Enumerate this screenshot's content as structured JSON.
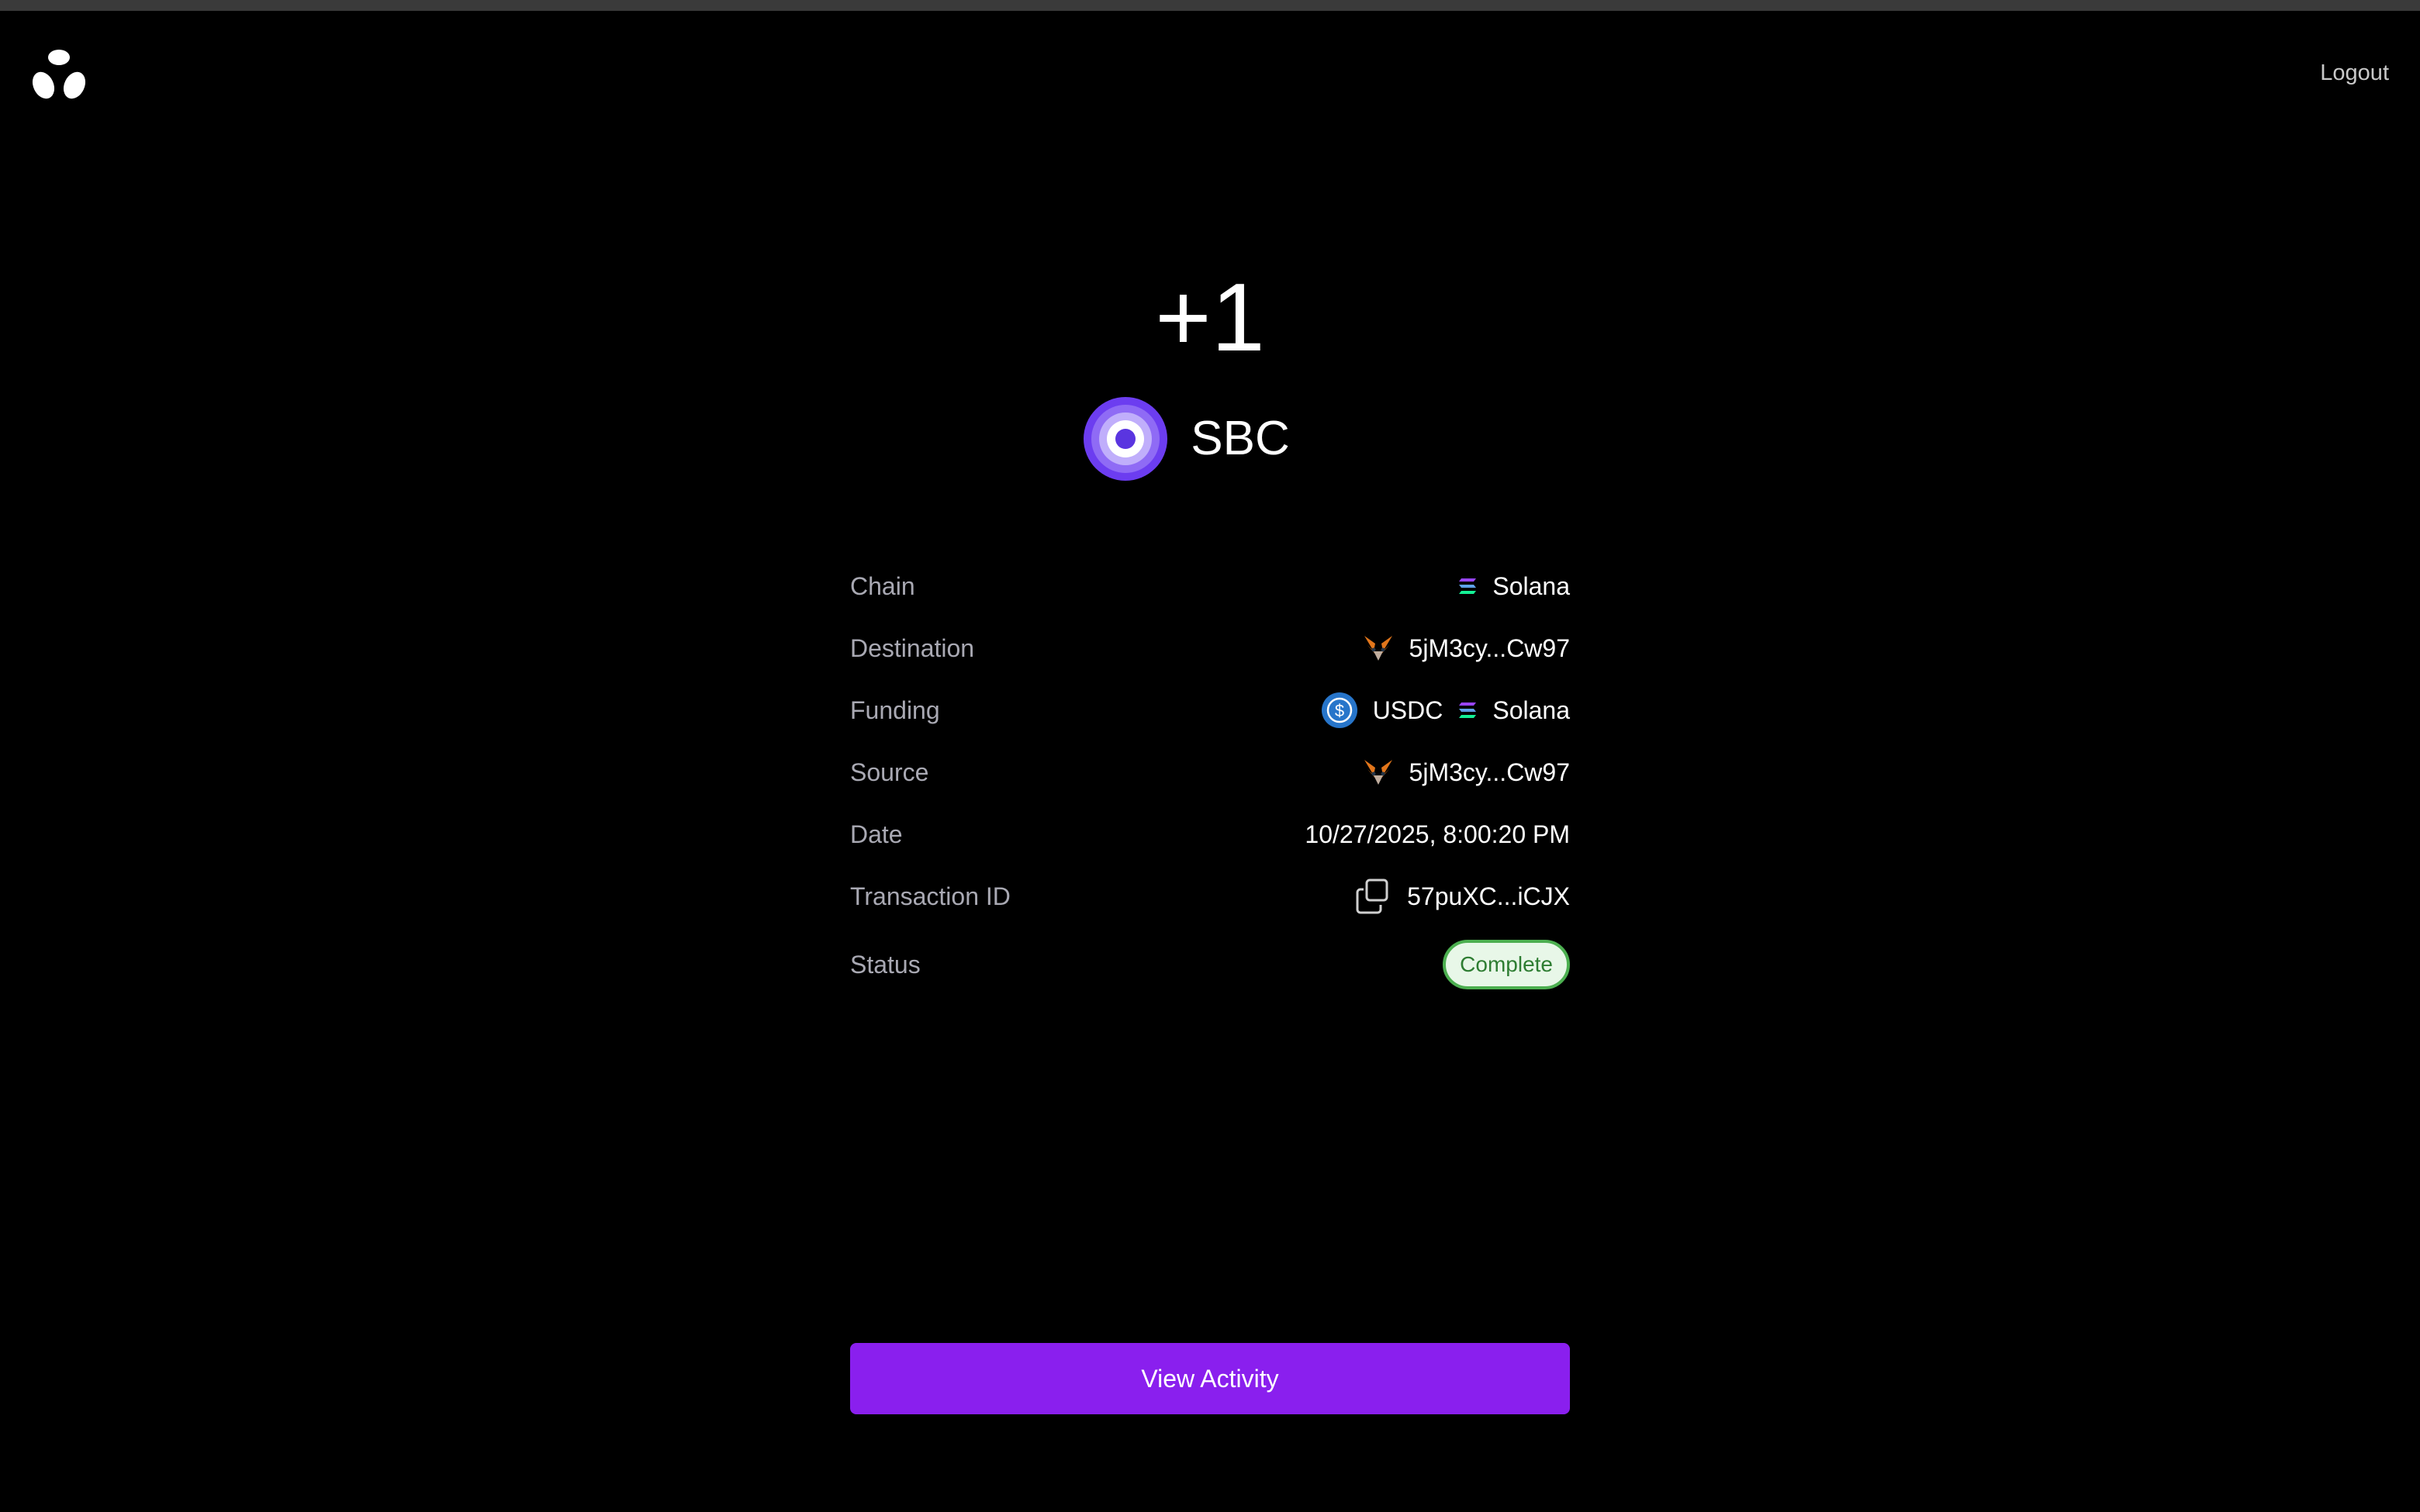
{
  "header": {
    "logo_icon": "tri-petal-logo-icon",
    "logout_label": "Logout"
  },
  "transaction": {
    "amount": "+1",
    "token_symbol": "SBC",
    "token_icon": "sbc-token-icon"
  },
  "details": {
    "chain": {
      "label": "Chain",
      "value": "Solana",
      "icon": "solana-icon"
    },
    "destination": {
      "label": "Destination",
      "value": "5jM3cy...Cw97",
      "icon": "metamask-fox-icon"
    },
    "funding": {
      "label": "Funding",
      "token": "USDC",
      "token_icon": "usdc-icon",
      "chain": "Solana",
      "chain_icon": "solana-icon"
    },
    "source": {
      "label": "Source",
      "value": "5jM3cy...Cw97",
      "icon": "metamask-fox-icon"
    },
    "date": {
      "label": "Date",
      "value": "10/27/2025, 8:00:20 PM"
    },
    "transaction_id": {
      "label": "Transaction ID",
      "value": "57puXC...iCJX",
      "icon": "copy-icon"
    },
    "status": {
      "label": "Status",
      "value": "Complete",
      "color": "#4caf50"
    }
  },
  "actions": {
    "view_activity_label": "View Activity",
    "accent_color": "#8a1fee"
  }
}
